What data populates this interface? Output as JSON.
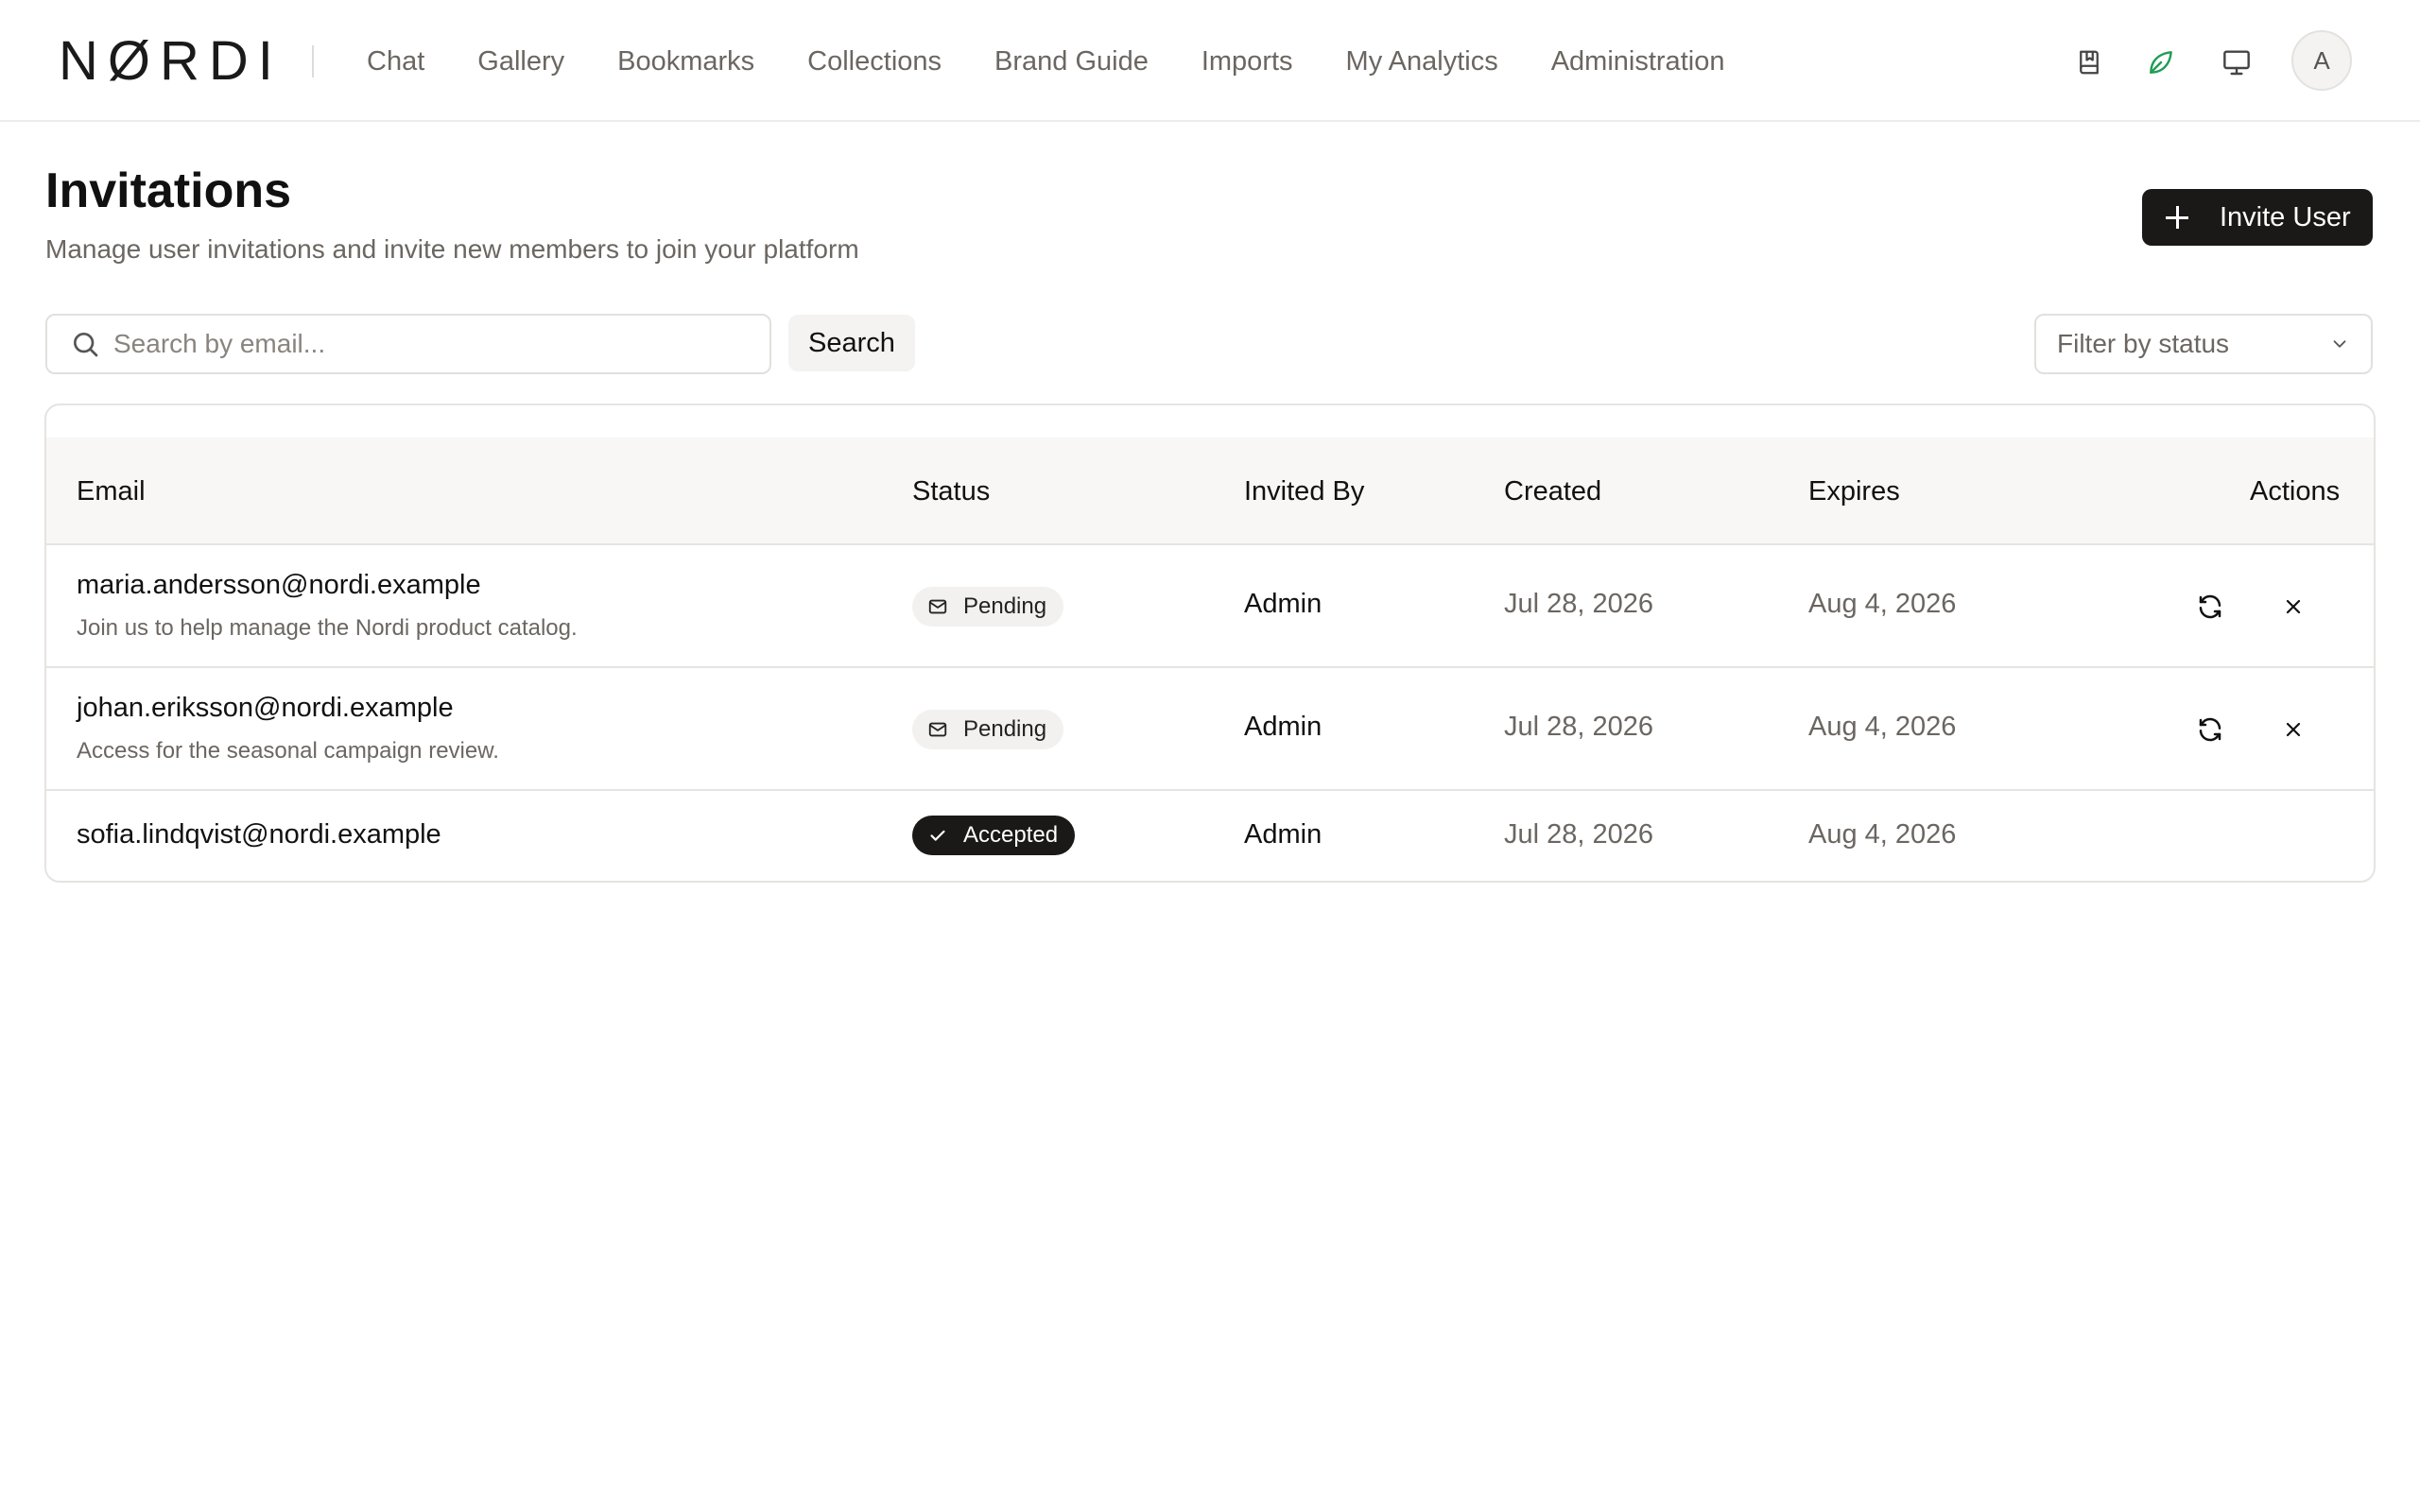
{
  "header": {
    "logo": "NØRDI",
    "nav": [
      "Chat",
      "Gallery",
      "Bookmarks",
      "Collections",
      "Brand Guide",
      "Imports",
      "My Analytics",
      "Administration"
    ],
    "avatar_initial": "A",
    "leaf_color": "#1f9d55"
  },
  "page": {
    "title": "Invitations",
    "subtitle": "Manage user invitations and invite new members to join your platform",
    "invite_button": "Invite User"
  },
  "search": {
    "placeholder": "Search by email...",
    "button": "Search",
    "filter_placeholder": "Filter by status"
  },
  "table": {
    "columns": [
      "Email",
      "Status",
      "Invited By",
      "Created",
      "Expires",
      "Actions"
    ],
    "rows": [
      {
        "email": "maria.andersson@nordi.example",
        "note": "Join us to help manage the Nordi product catalog.",
        "status": "Pending",
        "invited_by": "Admin",
        "created": "Jul 28, 2026",
        "expires": "Aug 4, 2026"
      },
      {
        "email": "johan.eriksson@nordi.example",
        "note": "Access for the seasonal campaign review.",
        "status": "Pending",
        "invited_by": "Admin",
        "created": "Jul 28, 2026",
        "expires": "Aug 4, 2026"
      },
      {
        "email": "sofia.lindqvist@nordi.example",
        "note": "",
        "status": "Accepted",
        "invited_by": "Admin",
        "created": "Jul 28, 2026",
        "expires": "Aug 4, 2026"
      }
    ]
  }
}
